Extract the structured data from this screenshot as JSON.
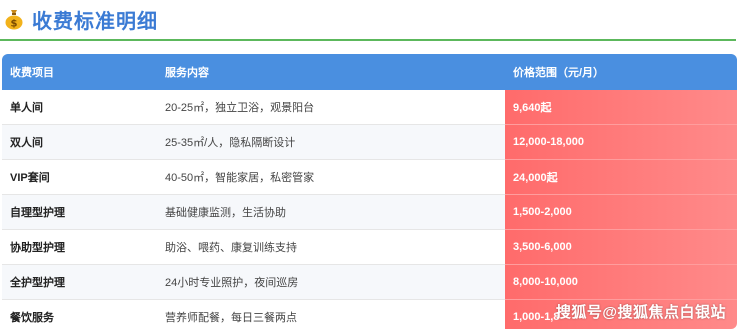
{
  "page": {
    "title": "收费标准明细",
    "header_icon": "money-bag-icon"
  },
  "table": {
    "headers": [
      "收费项目",
      "服务内容",
      "价格范围（元/月）"
    ],
    "rows": [
      {
        "item": "单人间",
        "service": "20-25㎡，独立卫浴，观景阳台",
        "price": "9,640起"
      },
      {
        "item": "双人间",
        "service": "25-35㎡/人，隐私隔断设计",
        "price": "12,000-18,000"
      },
      {
        "item": "VIP套间",
        "service": "40-50㎡，智能家居，私密管家",
        "price": "24,000起"
      },
      {
        "item": "自理型护理",
        "service": "基础健康监测，生活协助",
        "price": "1,500-2,000"
      },
      {
        "item": "协助型护理",
        "service": "助浴、喂药、康复训练支持",
        "price": "3,500-6,000"
      },
      {
        "item": "全护型护理",
        "service": "24小时专业照护，夜间巡房",
        "price": "8,000-10,000"
      },
      {
        "item": "餐饮服务",
        "service": "营养师配餐，每日三餐两点",
        "price": "1,000-1,8"
      }
    ]
  },
  "watermark": "搜狐号@搜狐焦点白银站",
  "colors": {
    "title": "#3b7bd4",
    "divider": "#5cb85c",
    "header_bg": "#4a8fe0",
    "price_bg": "#ff6b6b"
  }
}
